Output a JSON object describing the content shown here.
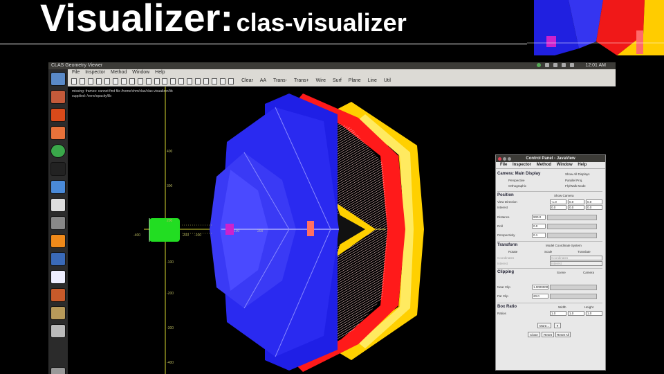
{
  "slide": {
    "title_main": "Visualizer:",
    "title_sub": "clas-visualizer"
  },
  "window": {
    "app_title": "CLAS Geometry Viewer",
    "clock": "12:01 AM"
  },
  "menubar": {
    "items": [
      "File",
      "Inspector",
      "Method",
      "Window",
      "Help"
    ]
  },
  "toolbar": {
    "buttons": [
      "Clear",
      "AA",
      "Trans-",
      "Trans+",
      "Wire",
      "Surf",
      "Plane",
      "Line",
      "Util"
    ]
  },
  "viewport": {
    "messages": [
      "missing: frames: cannot find file /home/vhm/clas/clas-visualizer/lib",
      "supplied: /venv/opacity/lib"
    ],
    "axis_numbers": {
      "y": [
        "400",
        "300",
        "200",
        "100",
        "-100",
        "-200",
        "-300",
        "-400"
      ],
      "x": [
        "-400",
        "-300",
        "-200",
        "-100",
        "100",
        "200",
        "300"
      ]
    }
  },
  "control_panel": {
    "title": "Control Panel - JavaView",
    "menu": [
      "File",
      "Inspector",
      "Method",
      "Window",
      "Help"
    ],
    "camera": {
      "header": "Camera: Main Display",
      "check_label": "Show All Displays",
      "options": [
        "Perspective",
        "Orthographic",
        "Parallel Proj.",
        "Fly/Walk Mode"
      ]
    },
    "position": {
      "header": "Position",
      "check_label": "Show Camera",
      "row_labels": [
        "View Direction",
        "Interest"
      ],
      "view_direction": [
        "-1.0",
        "0.0",
        "0.0"
      ],
      "interest": [
        "0.0",
        "0.0",
        "0.0"
      ],
      "slider_labels": [
        "Distance",
        "Roll",
        "Perspectivity"
      ],
      "slider_values": [
        "900.0",
        "0.0",
        "0.1"
      ]
    },
    "transform": {
      "header": "Transform",
      "check_label": "Model Coordinate System",
      "options": [
        "Rotate",
        "Scale",
        "Translate"
      ],
      "row_labels": [
        "Coordinates",
        "Interest"
      ],
      "field_values": [
        "Coordinates",
        "Interest"
      ]
    },
    "clipping": {
      "header": "Clipping",
      "options": [
        "Scene",
        "Camera"
      ],
      "slider_labels": [
        "Near Clip",
        "Far Clip"
      ],
      "slider_values": [
        "1.0000000",
        "20.0"
      ]
    },
    "box_ratio": {
      "header": "Box Ratio",
      "col_labels": [
        "Width",
        "Height"
      ],
      "row_label": "Ratios",
      "values": [
        "1.0",
        "1.0",
        "1.0"
      ]
    },
    "buttons": {
      "more": "More...",
      "close": "Close",
      "reset": "Reset",
      "reset_all": "Reset All"
    }
  },
  "colors": {
    "ec_red": "#ff1a1a",
    "ftof_yellow": "#ffd000",
    "dc_blue": "#1f1fe6",
    "target_green": "#22dd22",
    "magenta": "#cc22cc"
  }
}
